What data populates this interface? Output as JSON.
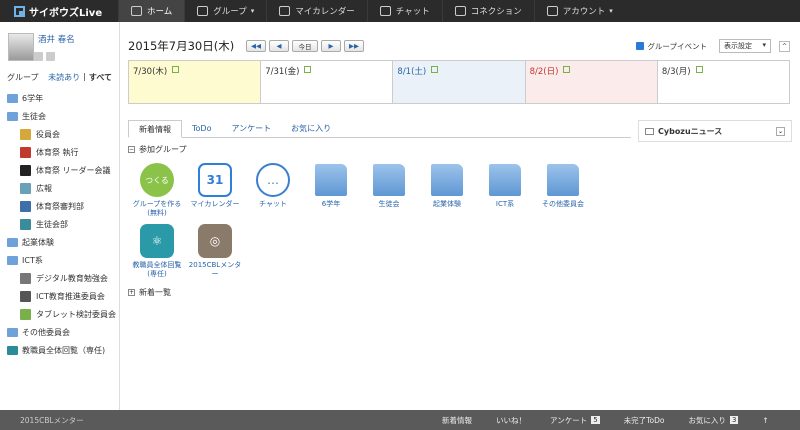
{
  "app": {
    "logo": "サイボウズLive"
  },
  "nav": [
    {
      "label": "ホーム",
      "active": true,
      "caret": ""
    },
    {
      "label": "グループ",
      "caret": "▾"
    },
    {
      "label": "マイカレンダー",
      "caret": ""
    },
    {
      "label": "チャット",
      "caret": ""
    },
    {
      "label": "コネクション",
      "caret": ""
    },
    {
      "label": "アカウント",
      "caret": "▾"
    }
  ],
  "profile": {
    "name": "酒井 春名"
  },
  "sidebar": {
    "tabs": {
      "group": "グループ",
      "unread": "未読あり",
      "sep": "|",
      "all": "すべて"
    },
    "items": [
      {
        "label": "6学年",
        "type": "folder"
      },
      {
        "label": "生徒会",
        "type": "folder"
      },
      {
        "label": "役員会",
        "type": "child",
        "color": "#d4a83a"
      },
      {
        "label": "体育祭 執行",
        "type": "child",
        "color": "#c23a2e"
      },
      {
        "label": "体育祭 リーダー会議",
        "type": "child",
        "color": "#222222"
      },
      {
        "label": "広報",
        "type": "child",
        "color": "#6aa0b8"
      },
      {
        "label": "体育祭審判部",
        "type": "child",
        "color": "#3d6fa8"
      },
      {
        "label": "生徒会部",
        "type": "child",
        "color": "#3a8c9a"
      },
      {
        "label": "起業体験",
        "type": "folder"
      },
      {
        "label": "ICT系",
        "type": "folder"
      },
      {
        "label": "デジタル教育勉強会",
        "type": "child",
        "color": "#777777"
      },
      {
        "label": "ICT教育推進委員会",
        "type": "child",
        "color": "#555555"
      },
      {
        "label": "タブレット検討委員会",
        "type": "child",
        "color": "#7ab04a"
      },
      {
        "label": "その他委員会",
        "type": "folder"
      },
      {
        "label": "教職員全体回覧（専任)",
        "type": "folder",
        "color": "#2a8c9a"
      }
    ]
  },
  "calendar": {
    "date": "2015年7月30日(木)",
    "today_btn": "今日",
    "btn_prev2": "◀◀",
    "btn_prev": "◀",
    "btn_next": "▶",
    "btn_next2": "▶▶",
    "group_event": "グループイベント",
    "display_setting": "表示設定",
    "select_caret": "▾",
    "collapse_icon": "^",
    "days": [
      {
        "label": "7/30(木)",
        "bg": "#fefbd0",
        "color": "#333333"
      },
      {
        "label": "7/31(金)",
        "bg": "#ffffff",
        "color": "#333333"
      },
      {
        "label": "8/1(土)",
        "bg": "#eaf1f9",
        "color": "#2a64a8"
      },
      {
        "label": "8/2(日)",
        "bg": "#fcebeb",
        "color": "#c0392b"
      },
      {
        "label": "8/3(月)",
        "bg": "#ffffff",
        "color": "#333333"
      }
    ]
  },
  "content_tabs": [
    "新着情報",
    "ToDo",
    "アンケート",
    "お気に入り"
  ],
  "sections": {
    "joined": "参加グループ",
    "news": "新着一覧",
    "joined_marker": "−",
    "news_marker": "+"
  },
  "apps": [
    {
      "label": "グループを作る(無料)",
      "kind": "circle",
      "color": "#8bc34a",
      "glyph": "つくる"
    },
    {
      "label": "マイカレンダー",
      "kind": "calendar",
      "color": "#2f7ed8",
      "glyph": "31"
    },
    {
      "label": "チャット",
      "kind": "chat",
      "color": "#3a7fd0",
      "glyph": "…"
    },
    {
      "label": "6学年",
      "kind": "folder"
    },
    {
      "label": "生徒会",
      "kind": "folder"
    },
    {
      "label": "起業体験",
      "kind": "folder"
    },
    {
      "label": "ICT系",
      "kind": "folder"
    },
    {
      "label": "その他委員会",
      "kind": "folder"
    },
    {
      "label": "教職員全体回覧(専任)",
      "kind": "atom",
      "color": "#2a9aa8",
      "glyph": "⚛"
    },
    {
      "label": "2015CBLメンター",
      "kind": "globe",
      "color": "#8a7a6a",
      "glyph": "◎"
    }
  ],
  "right_panel": {
    "title": "Cybozuニュース",
    "toggle": "⌄"
  },
  "bottom": {
    "left": "2015CBLメンター",
    "items": [
      {
        "label": "新着情報",
        "count": ""
      },
      {
        "label": "いいね！",
        "count": ""
      },
      {
        "label": "アンケート",
        "count": "5"
      },
      {
        "label": "未完了ToDo",
        "count": ""
      },
      {
        "label": "お気に入り",
        "count": "3"
      }
    ],
    "top_arrow": "↑"
  }
}
